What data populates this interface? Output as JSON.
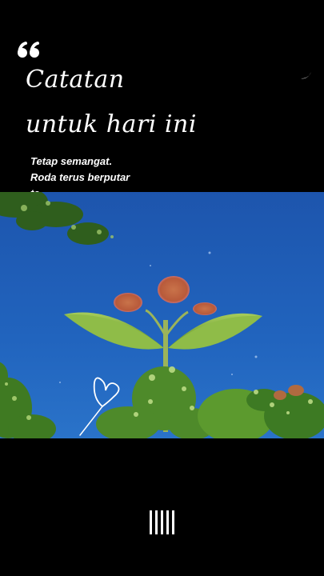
{
  "icons": {
    "quote": "quote-open-icon",
    "moon": "crescent-moon-icon",
    "heart": "heart-doodle-icon",
    "logo": "barcode-logo-icon"
  },
  "title": {
    "line1": "Catatan",
    "line2": "untuk hari ini"
  },
  "caption": {
    "line1": "Tetap semangat.",
    "line2": "Roda terus berputar",
    "line3": "te"
  },
  "colors": {
    "background": "#000000",
    "sky": "#1f5db8",
    "text": "#ffffff",
    "leaf": "#7fae3c",
    "petal": "#d96a46"
  }
}
